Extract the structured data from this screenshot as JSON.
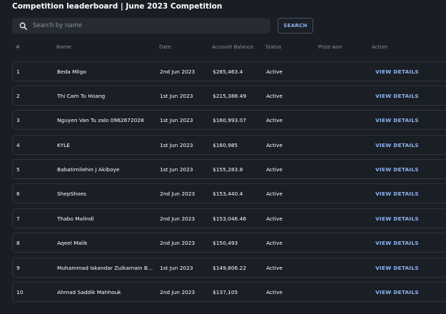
{
  "page": {
    "title": "Competition leaderboard | June 2023 Competition"
  },
  "search": {
    "placeholder": "Search by name",
    "button_label": "SEARCH"
  },
  "table": {
    "headers": {
      "num": "#",
      "name": "Name",
      "date": "Date",
      "balance": "Account Balance",
      "status": "Status",
      "prize": "Prize won",
      "action": "Action"
    },
    "rows": [
      {
        "num": "1",
        "name": "Beda Mligo",
        "date": "2nd Jun 2023",
        "balance": "$285,463.4",
        "status": "Active",
        "prize": "",
        "action": "VIEW DETAILS"
      },
      {
        "num": "2",
        "name": "Thi Cam Tu Hoang",
        "date": "1st Jun 2023",
        "balance": "$215,388.49",
        "status": "Active",
        "prize": "",
        "action": "VIEW DETAILS"
      },
      {
        "num": "3",
        "name": "Nguyen Van Tu zalo 0962672028",
        "date": "1st Jun 2023",
        "balance": "$160,993.07",
        "status": "Active",
        "prize": "",
        "action": "VIEW DETAILS"
      },
      {
        "num": "4",
        "name": "KYLE",
        "date": "1st Jun 2023",
        "balance": "$160,985",
        "status": "Active",
        "prize": "",
        "action": "VIEW DETAILS"
      },
      {
        "num": "5",
        "name": "Babatimilehin J Akiboye",
        "date": "1st Jun 2023",
        "balance": "$155,283.8",
        "status": "Active",
        "prize": "",
        "action": "VIEW DETAILS"
      },
      {
        "num": "6",
        "name": "ShepShoes",
        "date": "2nd Jun 2023",
        "balance": "$153,440.4",
        "status": "Active",
        "prize": "",
        "action": "VIEW DETAILS"
      },
      {
        "num": "7",
        "name": "Thabo Malindi",
        "date": "2nd Jun 2023",
        "balance": "$153,046.46",
        "status": "Active",
        "prize": "",
        "action": "VIEW DETAILS"
      },
      {
        "num": "8",
        "name": "Aqeel Malik",
        "date": "2nd Jun 2023",
        "balance": "$150,493",
        "status": "Active",
        "prize": "",
        "action": "VIEW DETAILS"
      },
      {
        "num": "9",
        "name": "Muhammad Iskandar Zulkarnain B...",
        "date": "1st Jun 2023",
        "balance": "$149,806.22",
        "status": "Active",
        "prize": "",
        "action": "VIEW DETAILS"
      },
      {
        "num": "10",
        "name": "Ahmad Saddik Mahhouk",
        "date": "2nd Jun 2023",
        "balance": "$137,105",
        "status": "Active",
        "prize": "",
        "action": "VIEW DETAILS"
      }
    ]
  },
  "icons": {
    "search": "search-icon"
  },
  "colors": {
    "background": "#191d24",
    "accent": "#8fb4ee",
    "row_border": "#2f353f"
  }
}
